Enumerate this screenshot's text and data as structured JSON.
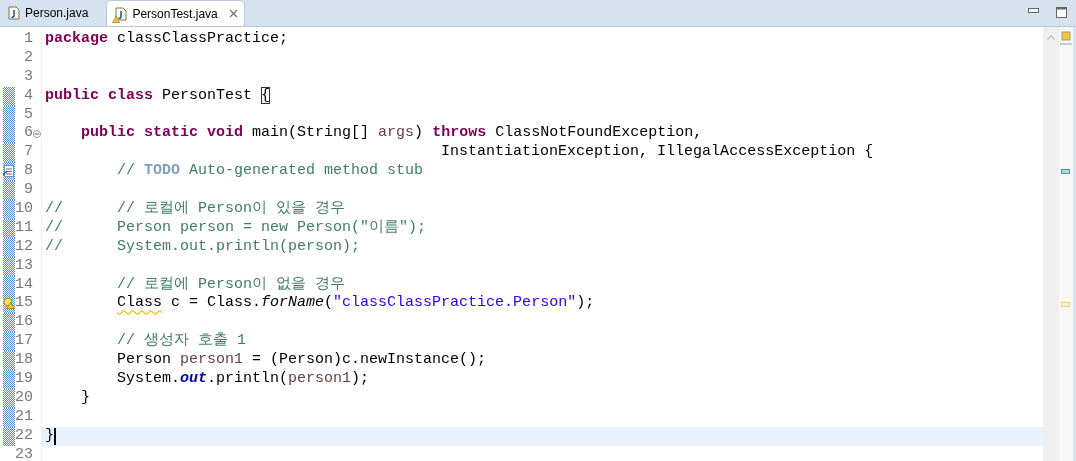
{
  "tabs": [
    {
      "label": "Person.java",
      "selected": false,
      "warning": false,
      "closable": false
    },
    {
      "label": "PersonTest.java",
      "selected": true,
      "warning": true,
      "closable": true
    }
  ],
  "lines": [
    {
      "number": "1",
      "kind": "plain",
      "current": false,
      "range": false,
      "tokens": [
        {
          "kind": "keyword",
          "text": "package"
        },
        {
          "kind": "plain",
          "text": " classClassPractice;"
        }
      ]
    },
    {
      "number": "2",
      "kind": "plain",
      "current": false,
      "range": false
    },
    {
      "number": "3",
      "kind": "plain",
      "current": false,
      "range": false
    },
    {
      "number": "4",
      "kind": "plain",
      "current": false,
      "range": true,
      "tokens": [
        {
          "kind": "keyword",
          "text": "public class"
        },
        {
          "kind": "plain",
          "text": " PersonTest "
        },
        {
          "kind": "bracket",
          "text": "{"
        }
      ]
    },
    {
      "number": "5",
      "kind": "plain",
      "current": false,
      "range": true
    },
    {
      "number": "6",
      "kind": "fold",
      "current": false,
      "range": true,
      "tokens": [
        {
          "kind": "keyword",
          "text": "    public static void"
        },
        {
          "kind": "plain",
          "text": " main(String[] "
        },
        {
          "kind": "variable",
          "text": "args"
        },
        {
          "kind": "plain",
          "text": ") "
        },
        {
          "kind": "keyword",
          "text": "throws"
        },
        {
          "kind": "plain",
          "text": " ClassNotFoundException,"
        }
      ]
    },
    {
      "number": "7",
      "kind": "plain",
      "current": false,
      "range": true,
      "tokens": [
        {
          "kind": "plain",
          "text": "                                            InstantiationException, IllegalAccessException {"
        }
      ]
    },
    {
      "number": "8",
      "kind": "task",
      "current": false,
      "range": true,
      "tokens": [
        {
          "kind": "comment",
          "text": "        // "
        },
        {
          "kind": "task",
          "text": "TODO"
        },
        {
          "kind": "comment",
          "text": " Auto-generated method stub"
        }
      ]
    },
    {
      "number": "9",
      "kind": "plain",
      "current": false,
      "range": true
    },
    {
      "number": "10",
      "kind": "plain",
      "current": false,
      "range": true,
      "tokens": [
        {
          "kind": "comment",
          "text": "//      // 로컬에 Person이 있을 경우"
        }
      ]
    },
    {
      "number": "11",
      "kind": "plain",
      "current": false,
      "range": true,
      "tokens": [
        {
          "kind": "comment",
          "text": "//      Person person = new Person(\"이름\");"
        }
      ]
    },
    {
      "number": "12",
      "kind": "plain",
      "current": false,
      "range": true,
      "tokens": [
        {
          "kind": "comment",
          "text": "//      System.out.println(person);"
        }
      ]
    },
    {
      "number": "13",
      "kind": "plain",
      "current": false,
      "range": true
    },
    {
      "number": "14",
      "kind": "plain",
      "current": false,
      "range": true,
      "tokens": [
        {
          "kind": "comment",
          "text": "        // 로컬에 Person이 없을 경우"
        }
      ]
    },
    {
      "number": "15",
      "kind": "warning",
      "current": false,
      "range": true,
      "tokens": [
        {
          "kind": "squiggle",
          "text": "        Class"
        },
        {
          "kind": "plain",
          "text": " c = Class."
        },
        {
          "kind": "static",
          "text": "forName"
        },
        {
          "kind": "plain",
          "text": "("
        },
        {
          "kind": "string",
          "text": "\"classClassPractice.Person\""
        },
        {
          "kind": "plain",
          "text": ");"
        }
      ]
    },
    {
      "number": "16",
      "kind": "plain",
      "current": false,
      "range": true
    },
    {
      "number": "17",
      "kind": "plain",
      "current": false,
      "range": true,
      "tokens": [
        {
          "kind": "comment",
          "text": "        // 생성자 호출 1"
        }
      ]
    },
    {
      "number": "18",
      "kind": "plain",
      "current": false,
      "range": true,
      "tokens": [
        {
          "kind": "plain",
          "text": "        Person "
        },
        {
          "kind": "variable",
          "text": "person1"
        },
        {
          "kind": "plain",
          "text": " = (Person)c.newInstance();"
        }
      ]
    },
    {
      "number": "19",
      "kind": "plain",
      "current": false,
      "range": true,
      "tokens": [
        {
          "kind": "plain",
          "text": "        System."
        },
        {
          "kind": "field",
          "text": "out"
        },
        {
          "kind": "plain",
          "text": ".println("
        },
        {
          "kind": "variable",
          "text": "person1"
        },
        {
          "kind": "plain",
          "text": ");"
        }
      ]
    },
    {
      "number": "20",
      "kind": "plain",
      "current": false,
      "range": true,
      "tokens": [
        {
          "kind": "plain",
          "text": "    }"
        }
      ]
    },
    {
      "number": "21",
      "kind": "plain",
      "current": false,
      "range": true
    },
    {
      "number": "22",
      "kind": "plain",
      "current": true,
      "range": true,
      "tokens": [
        {
          "kind": "plain",
          "text": "}"
        }
      ]
    },
    {
      "number": "23",
      "kind": "plain",
      "current": false,
      "range": false
    }
  ]
}
